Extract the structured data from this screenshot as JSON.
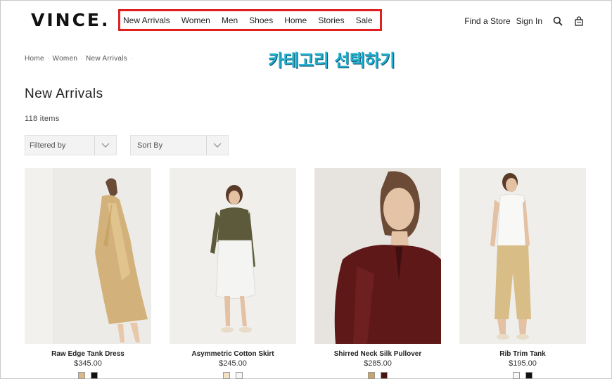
{
  "header": {
    "logo": "VINCE.",
    "nav": [
      "New Arrivals",
      "Women",
      "Men",
      "Shoes",
      "Home",
      "Stories",
      "Sale"
    ],
    "find_store": "Find a Store",
    "sign_in": "Sign In"
  },
  "breadcrumb": [
    "Home",
    "Women",
    "New Arrivals"
  ],
  "annotation": "카테고리 선택하기",
  "page_title": "New Arrivals",
  "item_count": "118 items",
  "filters": {
    "filter_label": "Filtered by",
    "sort_label": "Sort By"
  },
  "colors": {
    "highlight_box": "#e0201f",
    "annotation_text": "#1fb0cf"
  },
  "products": [
    {
      "name": "Raw Edge Tank Dress",
      "price": "$345.00",
      "swatches": [
        "#d9b98a",
        "#111111"
      ]
    },
    {
      "name": "Asymmetric Cotton Skirt",
      "price": "$245.00",
      "swatches": [
        "#f1e3c3",
        "#f7f7f7"
      ]
    },
    {
      "name": "Shirred Neck Silk Pullover",
      "price": "$285.00",
      "swatches": [
        "#c9a46a",
        "#4a1414"
      ]
    },
    {
      "name": "Rib Trim Tank",
      "price": "$195.00",
      "swatches": [
        "#f7f7f7",
        "#111111"
      ]
    }
  ]
}
